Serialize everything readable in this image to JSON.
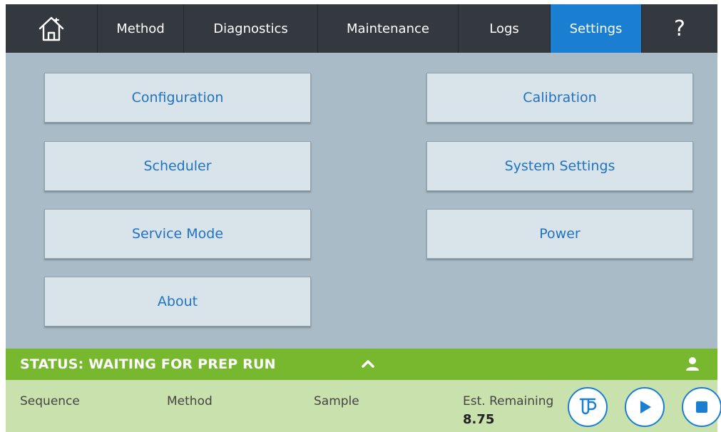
{
  "nav": {
    "home_icon": "home-icon",
    "method": "Method",
    "diagnostics": "Diagnostics",
    "maintenance": "Maintenance",
    "logs": "Logs",
    "settings": "Settings",
    "help": "?",
    "active": "Settings"
  },
  "tiles": {
    "configuration": "Configuration",
    "calibration": "Calibration",
    "scheduler": "Scheduler",
    "system_settings": "System Settings",
    "service_mode": "Service Mode",
    "power": "Power",
    "about": "About"
  },
  "status": {
    "text": "STATUS: WAITING FOR PREP RUN",
    "chevron_icon": "chevron-up-icon",
    "user_icon": "user-icon"
  },
  "info": {
    "sequence_label": "Sequence",
    "method_label": "Method",
    "sample_label": "Sample",
    "est_remaining_label": "Est. Remaining",
    "est_remaining_value": "8.75"
  },
  "controls": {
    "prep_icon": "prep-icon",
    "play_icon": "play-icon",
    "stop_icon": "stop-icon"
  },
  "colors": {
    "nav_bg": "#34393f",
    "nav_active": "#1a7ed1",
    "main_bg": "#a8bbc6",
    "tile_bg": "#d9e3ea",
    "tile_text": "#1f73c2",
    "status_bg": "#77b82f",
    "info_bg": "#c9e2ad"
  }
}
